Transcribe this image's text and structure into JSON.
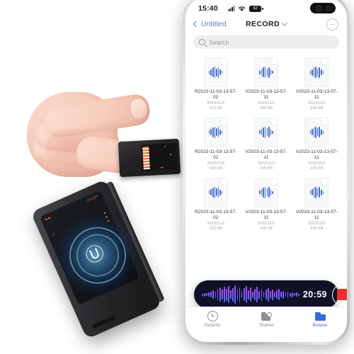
{
  "phone": {
    "status_bar": {
      "time": "15:40",
      "signal_icon": "cellular-signal-icon",
      "wifi_icon": "wifi-icon",
      "battery_icon": "battery-icon",
      "battery_label": "62"
    },
    "nav": {
      "back_label": "Untitled",
      "title": "RECORD",
      "more_label": "⋯"
    },
    "search": {
      "placeholder": "Search"
    },
    "files": [
      {
        "name": "R2023-11-03-13-57-02",
        "date": "2023/11/3",
        "size": "123 KB"
      },
      {
        "name": "V2023-11-03-13-57-11",
        "date": "2023/11/3",
        "size": "105 KB"
      },
      {
        "name": "V2023-11-03-13-57-11",
        "date": "2023/11/3",
        "size": "105 KB"
      },
      {
        "name": "R2023-11-03-13-57-02",
        "date": "2023/11/3",
        "size": "123 KB"
      },
      {
        "name": "V2023-11-03-13-57-11",
        "date": "2023/11/3",
        "size": "105 KB"
      },
      {
        "name": "V2023-11-03-13-57-11",
        "date": "2023/11/3",
        "size": "105 KB"
      },
      {
        "name": "R2023-11-03-13-57-02",
        "date": "2023/11/3",
        "size": "123 KB"
      },
      {
        "name": "V2023-11-03-13-57-11",
        "date": "2023/11/3",
        "size": "105 KB"
      },
      {
        "name": "V2023-11-03-13-57-11",
        "date": "2023/11/3",
        "size": "105 KB"
      }
    ],
    "recorder": {
      "elapsed_time": "20:59",
      "stop_button_label": "",
      "waveform_heights": [
        3,
        5,
        4,
        6,
        8,
        12,
        9,
        16,
        20,
        14,
        22,
        17,
        24,
        12,
        19,
        26,
        15,
        21,
        10,
        18,
        24,
        13,
        20,
        9,
        16,
        22,
        11,
        17,
        8,
        14,
        19,
        10,
        15,
        7,
        12,
        16,
        8,
        11,
        6,
        9,
        5,
        7,
        4,
        6,
        3
      ],
      "bar_background_color": "#0F1127",
      "wave_color_start": "#B54BFF",
      "wave_color_end": "#4F6BFF",
      "stop_color": "#F03030"
    },
    "tabs": [
      {
        "label": "Recents",
        "icon": "clock-icon",
        "active": false
      },
      {
        "label": "Shared",
        "icon": "shared-folder-icon",
        "active": false
      },
      {
        "label": "Browse",
        "icon": "folder-icon",
        "active": true
      }
    ],
    "accent_color": "#2F6DDD"
  },
  "product": {
    "mini_device": {
      "name": "mini-voice-recorder",
      "display_accent": "#E2622A"
    },
    "large_device": {
      "name": "voice-recorder",
      "glow_color": "#78CDFF",
      "display_accent": "#E0631F",
      "magnet_glyph": "Ⓤ"
    }
  }
}
